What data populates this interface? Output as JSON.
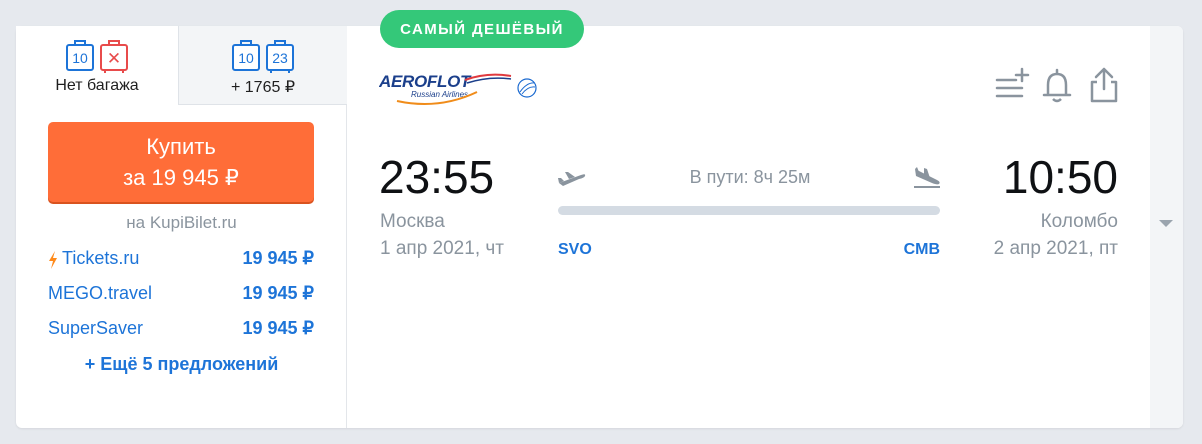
{
  "baggage_tabs": [
    {
      "label": "Нет багажа",
      "icons": [
        "10",
        "✕"
      ]
    },
    {
      "label": "+ 1765 ₽",
      "icons": [
        "10",
        "23"
      ]
    }
  ],
  "buy_button": {
    "line1": "Купить",
    "line2": "за 19 945 ₽"
  },
  "via_text": "на KupiBilet.ru",
  "offers": [
    {
      "name": "Tickets.ru",
      "price": "19 945 ₽",
      "bolt": true
    },
    {
      "name": "MEGO.travel",
      "price": "19 945 ₽"
    },
    {
      "name": "SuperSaver",
      "price": "19 945 ₽"
    }
  ],
  "more_offers": "+ Ещё 5 предложений",
  "badge": "САМЫЙ ДЕШЁВЫЙ",
  "airline": {
    "logo_text": "AEROFLOT",
    "logo_sub": "Russian Airlines"
  },
  "departure": {
    "time": "23:55",
    "city": "Москва",
    "date": "1 апр 2021, чт",
    "code": "SVO"
  },
  "arrival": {
    "time": "10:50",
    "city": "Коломбо",
    "date": "2 апр 2021, пт",
    "code": "CMB"
  },
  "duration": "В пути: 8ч 25м",
  "icons": {
    "add_list": "playlist-add-icon",
    "bell": "bell-icon",
    "share": "share-icon",
    "expand": "chevron-down-icon",
    "takeoff": "takeoff-icon",
    "landing": "landing-icon"
  },
  "colors": {
    "accent": "#ff6d38",
    "link": "#1d74d8",
    "badge": "#34c879",
    "icon": "#8a949e"
  }
}
